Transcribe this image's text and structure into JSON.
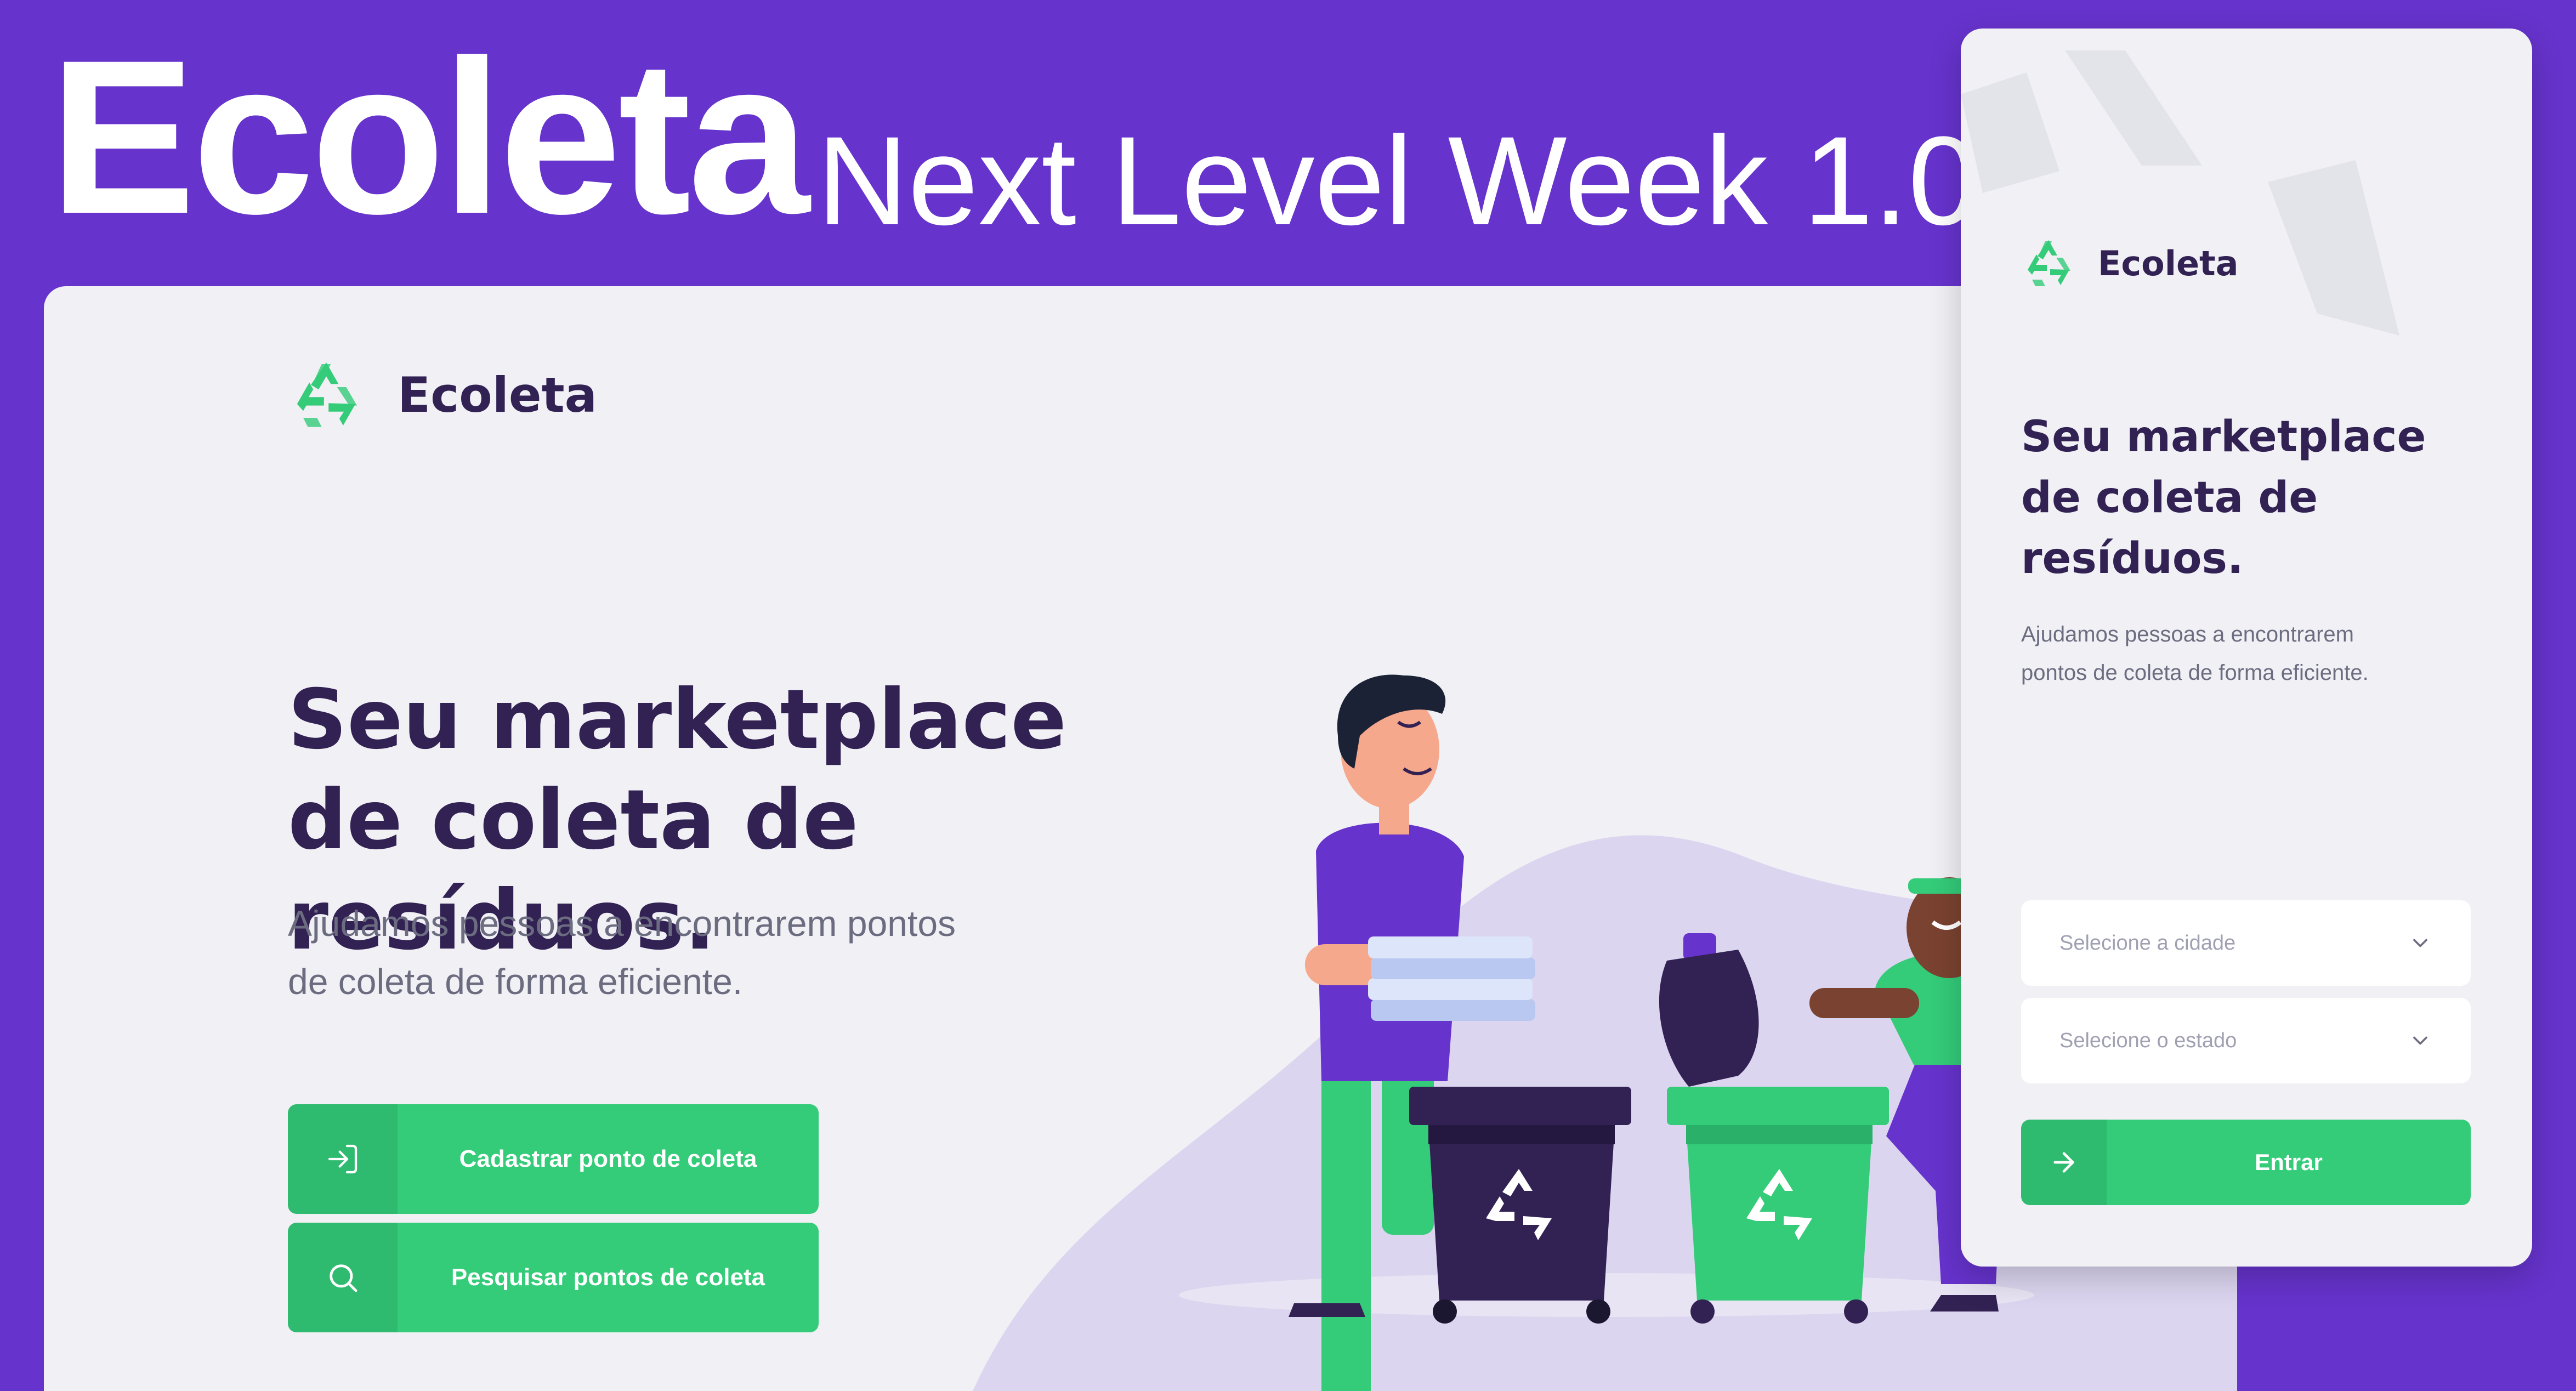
{
  "banner": {
    "title": "Ecoleta",
    "subtitle": "Next Level Week 1.0"
  },
  "colors": {
    "background": "#6633CC",
    "card": "#F0F0F5",
    "primary": "#34CB79",
    "title": "#322153",
    "text": "#6C6C80",
    "placeholder": "#A0A0B2"
  },
  "desktop": {
    "brand": "Ecoleta",
    "headline_line1": "Seu marketplace",
    "headline_line2": "de coleta de resíduos.",
    "description_line1": "Ajudamos pessoas a encontrarem pontos",
    "description_line2": "de coleta de forma eficiente.",
    "buttons": [
      {
        "label": "Cadastrar ponto de coleta",
        "icon": "log-in-icon"
      },
      {
        "label": "Pesquisar pontos de coleta",
        "icon": "search-icon"
      }
    ]
  },
  "mobile": {
    "brand": "Ecoleta",
    "headline_line1": "Seu marketplace",
    "headline_line2": "de coleta de",
    "headline_line3": "resíduos.",
    "description_line1": "Ajudamos pessoas a encontrarem",
    "description_line2": "pontos de coleta de forma eficiente.",
    "city_select": {
      "placeholder": "Selecione a cidade",
      "icon": "chevron-down-icon"
    },
    "state_select": {
      "placeholder": "Selecione o estado",
      "icon": "chevron-down-icon"
    },
    "enter_button": {
      "label": "Entrar",
      "icon": "arrow-right-icon"
    }
  }
}
